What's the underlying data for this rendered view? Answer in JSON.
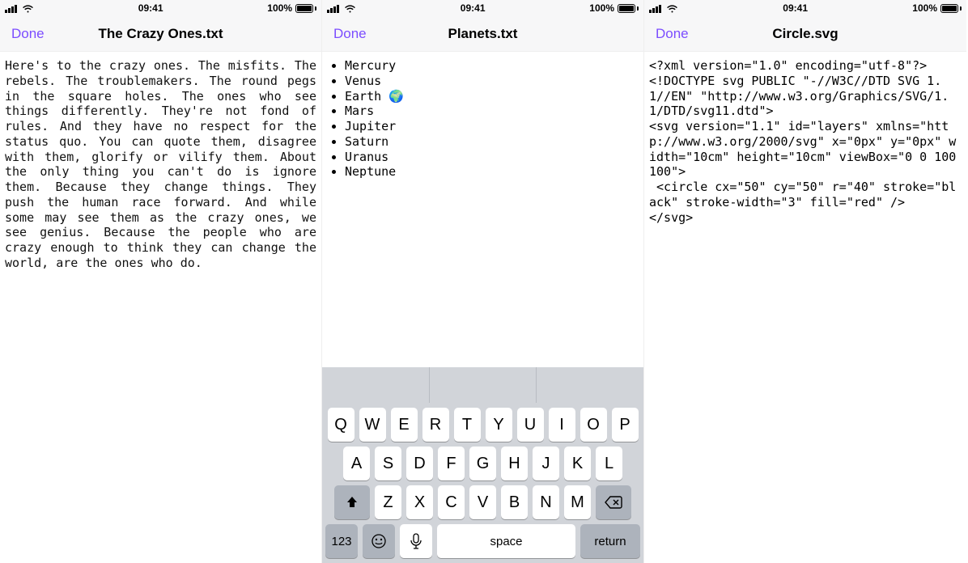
{
  "status": {
    "time": "09:41",
    "battery": "100%"
  },
  "nav": {
    "done": "Done"
  },
  "screens": [
    {
      "title": "The Crazy Ones.txt",
      "body": "Here's to the crazy ones. The misfits. The rebels. The troublemakers. The round pegs in the square holes. The ones who see things differently. They're not fond of rules. And they have no respect for the status quo. You can quote them, disagree with them, glorify or vilify them. About the only thing you can't do is ignore them. Because they change things. They push the human race forward. And while some may see them as the crazy ones, we see genius. Because the people who are crazy enough to think they can change the world, are the ones who do."
    },
    {
      "title": "Planets.txt",
      "planets": [
        "Mercury",
        "Venus",
        "Earth 🌍",
        "Mars",
        "Jupiter",
        "Saturn",
        "Uranus",
        "Neptune"
      ]
    },
    {
      "title": "Circle.svg",
      "code": "<?xml version=\"1.0\" encoding=\"utf-8\"?>\n<!DOCTYPE svg PUBLIC \"-//W3C//DTD SVG 1.1//EN\" \"http://www.w3.org/Graphics/SVG/1.1/DTD/svg11.dtd\">\n<svg version=\"1.1\" id=\"layers\" xmlns=\"http://www.w3.org/2000/svg\" x=\"0px\" y=\"0px\" width=\"10cm\" height=\"10cm\" viewBox=\"0 0 100 100\">\n <circle cx=\"50\" cy=\"50\" r=\"40\" stroke=\"black\" stroke-width=\"3\" fill=\"red\" />\n</svg>"
    }
  ],
  "keyboard": {
    "row1": [
      "Q",
      "W",
      "E",
      "R",
      "T",
      "Y",
      "U",
      "I",
      "O",
      "P"
    ],
    "row2": [
      "A",
      "S",
      "D",
      "F",
      "G",
      "H",
      "J",
      "K",
      "L"
    ],
    "row3": [
      "Z",
      "X",
      "C",
      "V",
      "B",
      "N",
      "M"
    ],
    "numKey": "123",
    "space": "space",
    "return": "return"
  }
}
